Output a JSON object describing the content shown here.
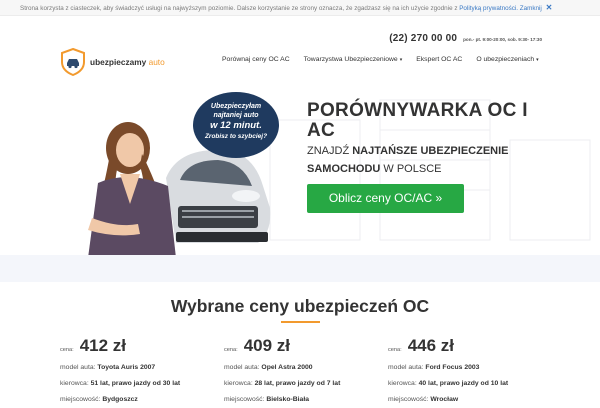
{
  "cookie": {
    "text": "Strona korzysta z ciasteczek, aby świadczyć usługi na najwyższym poziomie. Dalsze korzystanie ze strony oznacza, że zgadzasz się na ich użycie zgodnie z",
    "link": "Polityką prywatności.",
    "close": "Zamknij",
    "close_icon": "✕"
  },
  "header": {
    "phone": "(22) 270 00 00",
    "hours": "pon.- pt. 9:00-20:00, sob. 9:30- 17:30",
    "logo_main": "ubezpieczamy",
    "logo_accent": "auto"
  },
  "nav": {
    "items": [
      {
        "label": "Porównaj ceny OC AC",
        "dropdown": false
      },
      {
        "label": "Towarzystwa Ubezpieczeniowe",
        "dropdown": true
      },
      {
        "label": "Ekspert OC AC",
        "dropdown": false
      },
      {
        "label": "O ubezpieczeniach",
        "dropdown": true
      }
    ],
    "caret": "▾"
  },
  "hero": {
    "bubble_line1": "Ubezpieczyłam",
    "bubble_line2": "najtaniej auto",
    "bubble_line3": "w 12 minut.",
    "bubble_line4": "Zrobisz to szybciej?",
    "title": "PORÓWNYWARKA OC I AC",
    "sub_prefix": "ZNAJDŹ",
    "sub_bold": "NAJTAŃSZE UBEZPIECZENIE SAMOCHODU",
    "sub_suffix": "W POLSCE",
    "cta": "Oblicz ceny OC/AC »"
  },
  "offers": {
    "title": "Wybrane ceny ubezpieczeń OC",
    "price_label": "cena:",
    "model_label": "model auta:",
    "driver_label": "kierowca:",
    "city_label": "miejscowość:",
    "items": [
      {
        "price": "412 zł",
        "model": "Toyota Auris 2007",
        "driver": "51 lat, prawo jazdy od 30 lat",
        "city": "Bydgoszcz"
      },
      {
        "price": "409 zł",
        "model": "Opel Astra 2000",
        "driver": "28 lat, prawo jazdy od 7 lat",
        "city": "Bielsko-Biała"
      },
      {
        "price": "446 zł",
        "model": "Ford Focus 2003",
        "driver": "40 lat, prawo jazdy od 10 lat",
        "city": "Wrocław"
      }
    ]
  },
  "colors": {
    "accent": "#f29a2e",
    "cta": "#27a844",
    "bubble": "#1f3a5f",
    "link": "#3a79c4"
  }
}
